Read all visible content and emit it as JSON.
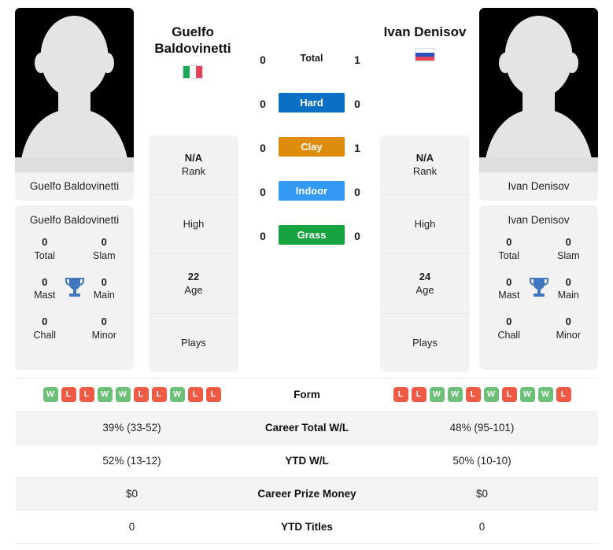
{
  "players": {
    "left": {
      "name": "Guelfo Baldovinetti",
      "display_name_line1": "Guelfo",
      "display_name_line2": "Baldovinetti",
      "country": "Italy",
      "flag": "it",
      "avatar": "player-placeholder-silhouette",
      "rank": "N/A",
      "rank_label": "Rank",
      "high_label": "High",
      "high_value": "",
      "age": "22",
      "age_label": "Age",
      "plays_label": "Plays",
      "plays_value": "",
      "titles": [
        {
          "value": "0",
          "label": "Total"
        },
        {
          "value": "0",
          "label": "Slam"
        },
        {
          "value": "0",
          "label": "Mast"
        },
        {
          "value": "0",
          "label": "Main"
        },
        {
          "value": "0",
          "label": "Chall"
        },
        {
          "value": "0",
          "label": "Minor"
        }
      ],
      "form": [
        "W",
        "L",
        "L",
        "W",
        "W",
        "L",
        "L",
        "W",
        "L",
        "L"
      ],
      "career_total_wl": "39% (33-52)",
      "ytd_wl": "52% (13-12)",
      "career_prize_money": "$0",
      "ytd_titles": "0"
    },
    "right": {
      "name": "Ivan Denisov",
      "display_name_line1": "Ivan Denisov",
      "display_name_line2": "",
      "country": "Russia",
      "flag": "ru",
      "avatar": "player-placeholder-silhouette",
      "rank": "N/A",
      "rank_label": "Rank",
      "high_label": "High",
      "high_value": "",
      "age": "24",
      "age_label": "Age",
      "plays_label": "Plays",
      "plays_value": "",
      "titles": [
        {
          "value": "0",
          "label": "Total"
        },
        {
          "value": "0",
          "label": "Slam"
        },
        {
          "value": "0",
          "label": "Mast"
        },
        {
          "value": "0",
          "label": "Main"
        },
        {
          "value": "0",
          "label": "Chall"
        },
        {
          "value": "0",
          "label": "Minor"
        }
      ],
      "form": [
        "L",
        "L",
        "W",
        "W",
        "L",
        "W",
        "L",
        "W",
        "W",
        "L"
      ],
      "career_total_wl": "48% (95-101)",
      "ytd_wl": "50% (10-10)",
      "career_prize_money": "$0",
      "ytd_titles": "0"
    }
  },
  "head_to_head": {
    "rows": [
      {
        "label": "Total",
        "left": "0",
        "right": "1",
        "color": "transparent",
        "text_color": "#1c1c1c"
      },
      {
        "label": "Hard",
        "left": "0",
        "right": "0",
        "color": "#0b6fc4",
        "text_color": "#ffffff"
      },
      {
        "label": "Clay",
        "left": "0",
        "right": "1",
        "color": "#dd8c0b",
        "text_color": "#ffffff"
      },
      {
        "label": "Indoor",
        "left": "0",
        "right": "0",
        "color": "#3399f3",
        "text_color": "#ffffff"
      },
      {
        "label": "Grass",
        "left": "0",
        "right": "0",
        "color": "#17a33f",
        "text_color": "#ffffff"
      }
    ]
  },
  "comparison_table": {
    "rows": [
      {
        "label": "Form",
        "type": "form"
      },
      {
        "label": "Career Total W/L",
        "type": "text",
        "left": "39% (33-52)",
        "right": "48% (95-101)"
      },
      {
        "label": "YTD W/L",
        "type": "text",
        "left": "52% (13-12)",
        "right": "50% (10-10)"
      },
      {
        "label": "Career Prize Money",
        "type": "text",
        "left": "$0",
        "right": "$0"
      },
      {
        "label": "YTD Titles",
        "type": "text",
        "left": "0",
        "right": "0"
      }
    ]
  },
  "colors": {
    "hard": "#0b6fc4",
    "clay": "#dd8c0b",
    "indoor": "#3399f3",
    "grass": "#17a33f",
    "win": "#6cc077",
    "loss": "#ef5a45",
    "trophy": "#3f76bd",
    "card_bg": "#f2f2f2"
  }
}
